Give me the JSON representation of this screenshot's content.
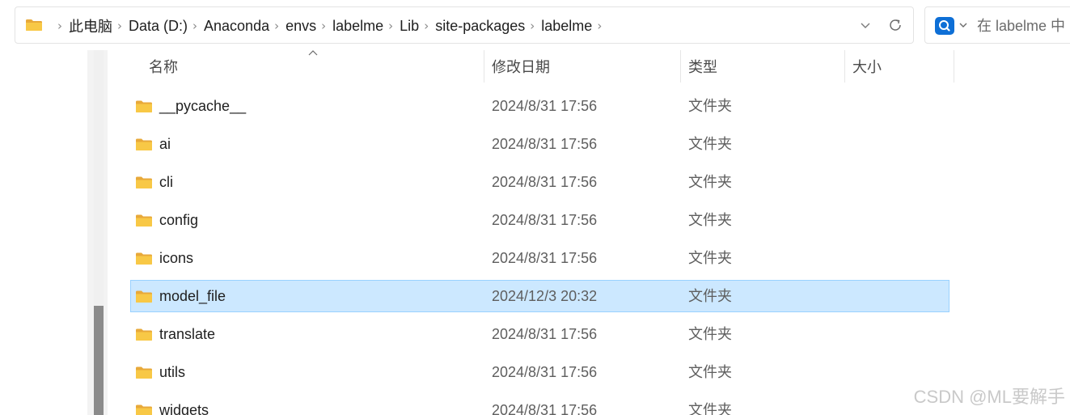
{
  "address_bar": {
    "breadcrumbs": [
      "此电脑",
      "Data (D:)",
      "Anaconda",
      "envs",
      "labelme",
      "Lib",
      "site-packages",
      "labelme"
    ],
    "separator": "›"
  },
  "search": {
    "placeholder": "在 labelme 中"
  },
  "columns": {
    "name": "名称",
    "modified": "修改日期",
    "type": "类型",
    "size": "大小"
  },
  "rows": [
    {
      "name": "__pycache__",
      "modified": "2024/8/31 17:56",
      "type": "文件夹",
      "selected": false
    },
    {
      "name": "ai",
      "modified": "2024/8/31 17:56",
      "type": "文件夹",
      "selected": false
    },
    {
      "name": "cli",
      "modified": "2024/8/31 17:56",
      "type": "文件夹",
      "selected": false
    },
    {
      "name": "config",
      "modified": "2024/8/31 17:56",
      "type": "文件夹",
      "selected": false
    },
    {
      "name": "icons",
      "modified": "2024/8/31 17:56",
      "type": "文件夹",
      "selected": false
    },
    {
      "name": "model_file",
      "modified": "2024/12/3 20:32",
      "type": "文件夹",
      "selected": true
    },
    {
      "name": "translate",
      "modified": "2024/8/31 17:56",
      "type": "文件夹",
      "selected": false
    },
    {
      "name": "utils",
      "modified": "2024/8/31 17:56",
      "type": "文件夹",
      "selected": false
    },
    {
      "name": "widgets",
      "modified": "2024/8/31 17:56",
      "type": "文件夹",
      "selected": false
    }
  ],
  "watermark": "CSDN @ML要解手",
  "colors": {
    "selection_bg": "#cce8ff",
    "selection_border": "#99d1ff",
    "folder_yellow": "#f8c846",
    "search_accent": "#0e6fd6"
  },
  "icons": {
    "address_folder": "folder-icon",
    "dropdown": "chevron-down-icon",
    "refresh": "refresh-icon",
    "search": "search-icon",
    "sort": "sort-ascending-icon",
    "row_folder": "folder-icon"
  }
}
